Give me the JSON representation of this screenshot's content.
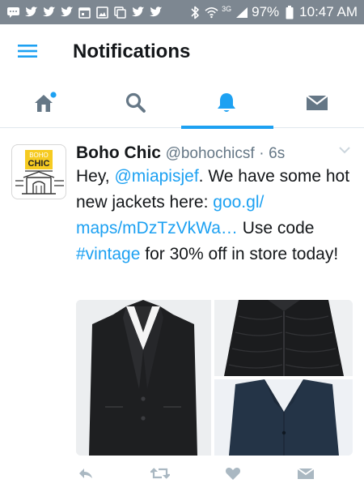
{
  "status_bar": {
    "network_label": "3G",
    "battery": "97%",
    "time": "10:47 AM"
  },
  "header": {
    "title": "Notifications",
    "menu_icon": "hamburger-menu-icon"
  },
  "tabs": [
    {
      "name": "home",
      "icon": "home-icon",
      "active": false,
      "has_dot": true
    },
    {
      "name": "search",
      "icon": "search-icon",
      "active": false
    },
    {
      "name": "notifications",
      "icon": "bell-icon",
      "active": true
    },
    {
      "name": "messages",
      "icon": "envelope-icon",
      "active": false
    }
  ],
  "tweet": {
    "avatar_text_top": "BOHO",
    "avatar_text_bottom": "CHIC",
    "author_name": "Boho Chic",
    "handle": "@bohochicsf",
    "separator": "·",
    "time": "6s",
    "text_1": "Hey, ",
    "mention": "@miapisjef",
    "text_2": ". We have some hot new jackets here: ",
    "url": "goo.gl/​maps/mDzTzVkWa…",
    "text_3": " Use code ",
    "hashtag": "#vintage",
    "text_4": " for 30% off in store today!",
    "media": [
      {
        "name": "black-blazer"
      },
      {
        "name": "black-quilted-jacket"
      },
      {
        "name": "navy-blazer"
      }
    ],
    "actions": [
      "reply-icon",
      "retweet-icon",
      "like-icon",
      "direct-message-icon"
    ]
  },
  "colors": {
    "accent": "#1da1f2",
    "icon_gray": "#657786",
    "action_gray": "#aab8c2",
    "status_bar_bg": "#7d8791"
  }
}
